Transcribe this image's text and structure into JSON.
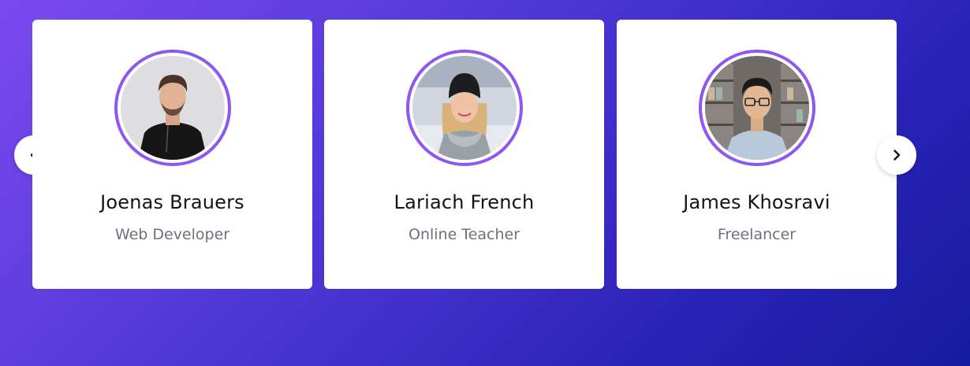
{
  "slider": {
    "cards": [
      {
        "name": "Joenas Brauers",
        "role": "Web Developer",
        "avatar_icon": "avatar-photo-man-black-shirt"
      },
      {
        "name": "Lariach French",
        "role": "Online Teacher",
        "avatar_icon": "avatar-photo-woman-beanie"
      },
      {
        "name": "James Khosravi",
        "role": "Freelancer",
        "avatar_icon": "avatar-photo-man-glasses"
      }
    ],
    "prev_icon": "chevron-left-icon",
    "next_icon": "chevron-right-icon"
  },
  "colors": {
    "accent": "#8f56f0",
    "background_start": "#7b4af0",
    "background_end": "#141c9e",
    "card": "#ffffff",
    "name_text": "#141414",
    "role_text": "#707078"
  }
}
